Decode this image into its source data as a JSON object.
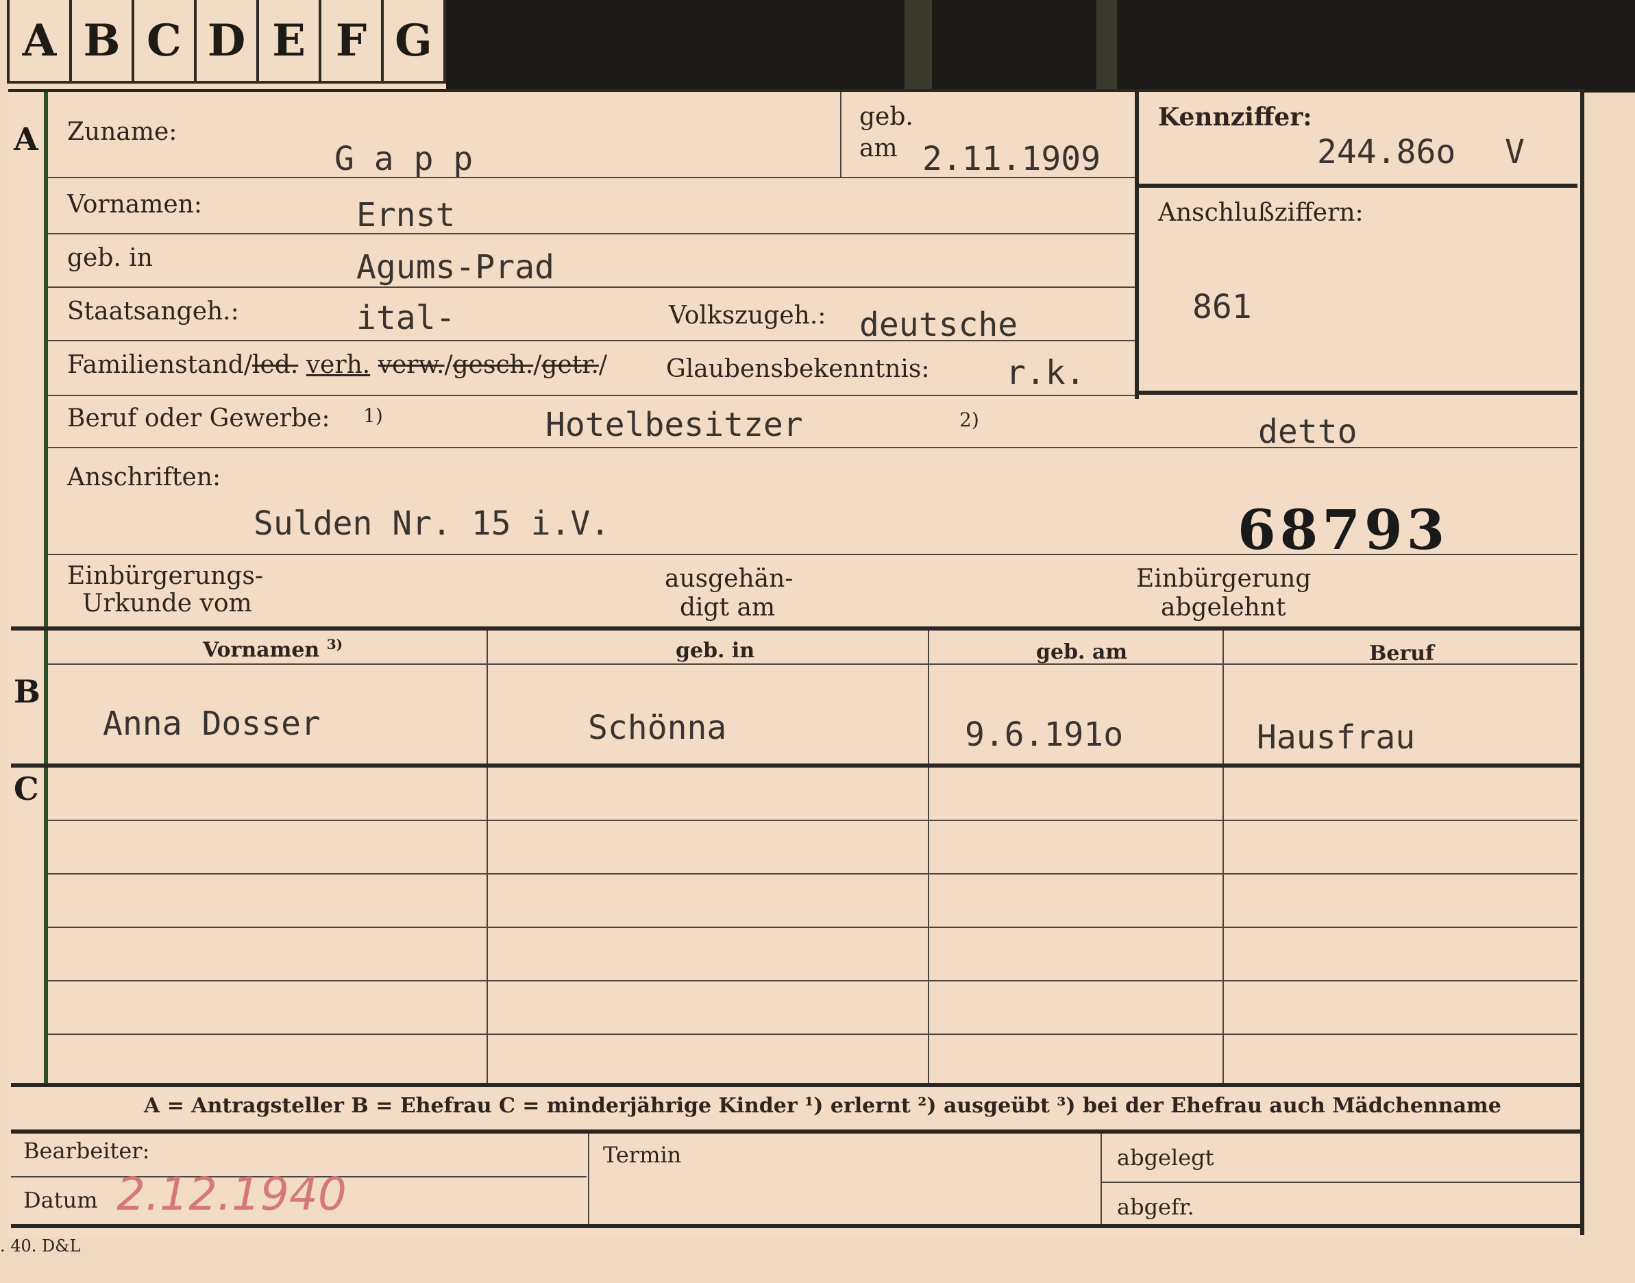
{
  "tabs": [
    "A",
    "B",
    "C",
    "D",
    "E",
    "F",
    "G"
  ],
  "sections": {
    "a": "A",
    "b": "B",
    "c": "C"
  },
  "labels": {
    "zuname": "Zuname:",
    "geb": "geb.",
    "am": "am",
    "kennziffer": "Kennziffer:",
    "vornamen": "Vornamen:",
    "anschlussziffern": "Anschlußziffern:",
    "geb_in": "geb. in",
    "staatsangeh": "Staatsangeh.:",
    "volkszugeh": "Volkszugeh.:",
    "familienstand": "Familienstand",
    "familienstand_options": [
      "led.",
      "verh.",
      "verw.",
      "gesch.",
      "getr."
    ],
    "glaubensbekenntnis": "Glaubensbekenntnis:",
    "beruf": "Beruf oder Gewerbe:",
    "note1": "1)",
    "note2": "2)",
    "anschriften": "Anschriften:",
    "einbuergerungs_urkunde_1": "Einbürgerungs-",
    "einbuergerungs_urkunde_2": "Urkunde vom",
    "ausgehaendigt_1": "ausgehän-",
    "ausgehaendigt_2": "digt am",
    "einbuergerung_abgelehnt_1": "Einbürgerung",
    "einbuergerung_abgelehnt_2": "abgelehnt"
  },
  "values": {
    "zuname": "G a p p",
    "geb_am": "2.11.1909",
    "kennziffer": "244.86o",
    "kennziffer_suffix": "V",
    "vornamen": "Ernst",
    "anschlussziffer": "861",
    "geb_in": "Agums-Prad",
    "staatsangeh": "ital-",
    "volkszugeh": "deutsche",
    "glaubensbekenntnis": "r.k.",
    "beruf1": "Hotelbesitzer",
    "beruf2": "detto",
    "anschrift": "Sulden Nr. 15 i.V.",
    "stamp_number": "68793"
  },
  "section_b": {
    "headers": [
      "Vornamen",
      "geb. in",
      "geb. am",
      "Beruf"
    ],
    "header_note": "3)",
    "row": [
      "Anna Dosser",
      "Schönna",
      "9.6.191o",
      "Hausfrau"
    ]
  },
  "legend": "A = Antragsteller   B = Ehefrau   C = minderjährige Kinder   ¹) erlernt   ²) ausgeübt   ³) bei der Ehefrau auch Mädchenname",
  "footer": {
    "bearbeiter": "Bearbeiter:",
    "datum": "Datum",
    "datum_value": "2.12.1940",
    "termin": "Termin",
    "abgelegt": "abgelegt",
    "abgefr": "abgefr."
  },
  "print_code": ". 40. D&L"
}
